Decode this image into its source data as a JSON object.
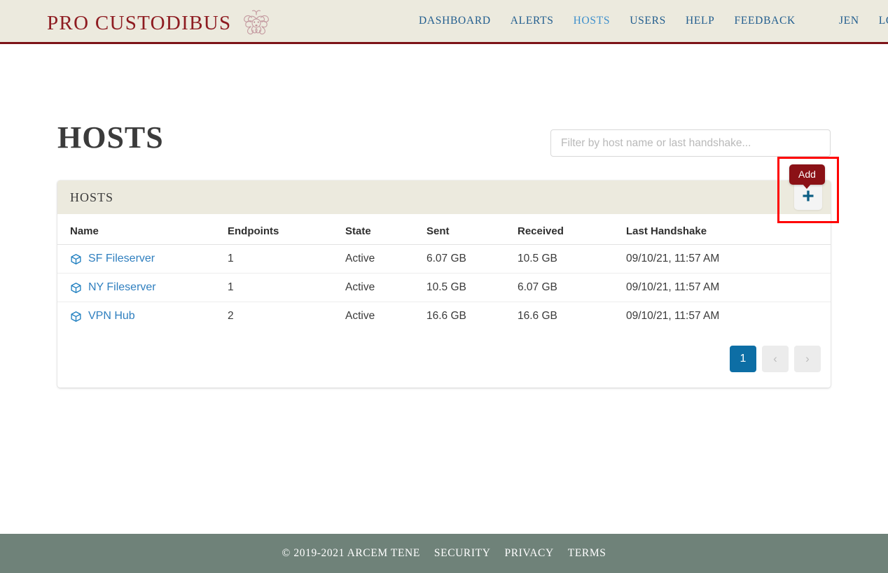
{
  "header": {
    "brand_text": "PRO CUSTODIBUS",
    "emblem_icon": "medusa-emblem-icon",
    "nav": [
      {
        "label": "DASHBOARD",
        "active": false
      },
      {
        "label": "ALERTS",
        "active": false
      },
      {
        "label": "HOSTS",
        "active": true
      },
      {
        "label": "USERS",
        "active": false
      },
      {
        "label": "HELP",
        "active": false
      },
      {
        "label": "FEEDBACK",
        "active": false
      }
    ],
    "account": [
      {
        "label": "JEN"
      },
      {
        "label": "LOG OUT"
      }
    ]
  },
  "main": {
    "page_title": "HOSTS",
    "filter": {
      "placeholder": "Filter by host name or last handshake...",
      "value": ""
    },
    "add_button": {
      "tooltip": "Add",
      "icon": "plus-icon"
    },
    "card": {
      "title": "HOSTS",
      "columns": [
        "Name",
        "Endpoints",
        "State",
        "Sent",
        "Received",
        "Last Handshake"
      ],
      "rows": [
        {
          "icon": "cube-icon",
          "name": "SF Fileserver",
          "endpoints": "1",
          "state": "Active",
          "sent": "6.07 GB",
          "received": "10.5 GB",
          "last_handshake": "09/10/21, 11:57 AM"
        },
        {
          "icon": "cube-icon",
          "name": "NY Fileserver",
          "endpoints": "1",
          "state": "Active",
          "sent": "10.5 GB",
          "received": "6.07 GB",
          "last_handshake": "09/10/21, 11:57 AM"
        },
        {
          "icon": "cube-icon",
          "name": "VPN Hub",
          "endpoints": "2",
          "state": "Active",
          "sent": "16.6 GB",
          "received": "16.6 GB",
          "last_handshake": "09/10/21, 11:57 AM"
        }
      ],
      "pagination": {
        "current_page": "1",
        "prev_icon": "chevron-left-icon",
        "prev_label": "‹",
        "next_icon": "chevron-right-icon",
        "next_label": "›"
      }
    }
  },
  "footer": {
    "copyright": "© 2019-2021 ARCEM TENE",
    "links": [
      "SECURITY",
      "PRIVACY",
      "TERMS"
    ]
  },
  "colors": {
    "brand_red": "#8e1c21",
    "header_bg": "#eceade",
    "header_border": "#7d1418",
    "link_blue": "#2f7fbf",
    "nav_blue": "#215d8e",
    "nav_active_blue": "#3d8fcc",
    "state_green": "#4a8a34",
    "pagination_active": "#0d6ea5",
    "tooltip_bg": "#8b1116",
    "highlight_red": "#ff0000",
    "footer_bg": "#6f8279"
  }
}
